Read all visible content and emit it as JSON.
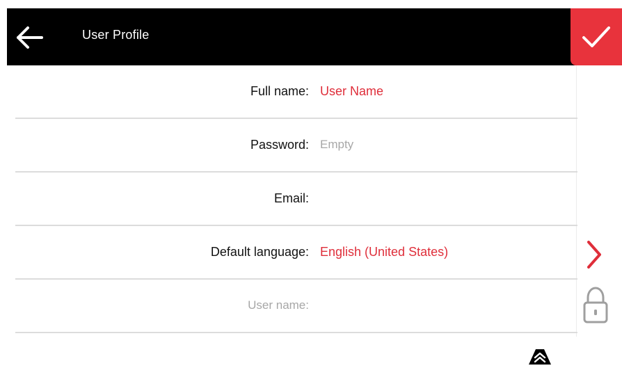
{
  "header": {
    "title": "User Profile",
    "back_icon": "arrow-left-icon",
    "confirm_icon": "checkmark-icon",
    "accent_color": "#e8333c"
  },
  "profile": {
    "rows": [
      {
        "label": "Full name:",
        "value": "User Name",
        "value_type": "value"
      },
      {
        "label": "Password:",
        "value": "Empty",
        "value_type": "placeholder"
      },
      {
        "label": "Email:",
        "value": "",
        "value_type": "value"
      },
      {
        "label": "Default language:",
        "value": "English (United States)",
        "value_type": "value"
      },
      {
        "label": "User name:",
        "value": "",
        "value_type": "disabled"
      }
    ]
  },
  "icons": {
    "chevron": "chevron-right-icon",
    "lock": "lock-icon",
    "scroll_top": "double-chevron-up-icon"
  }
}
